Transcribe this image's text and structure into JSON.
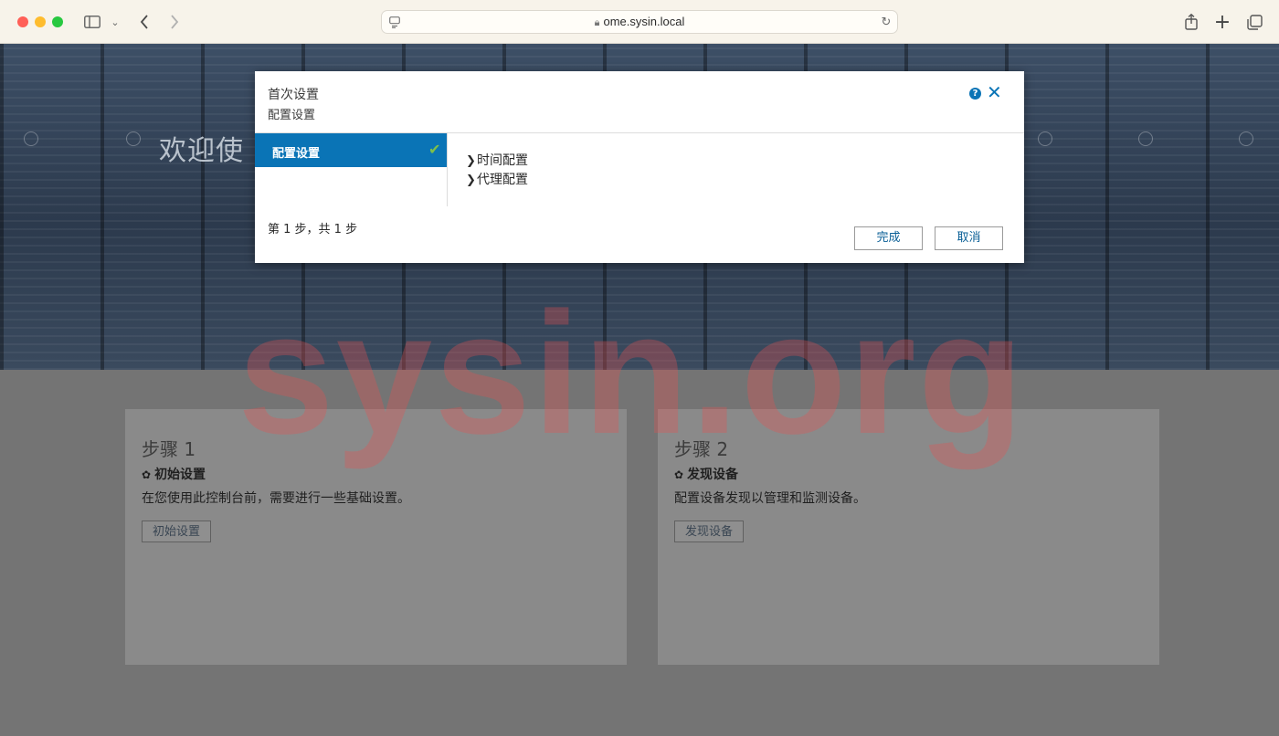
{
  "browser": {
    "url": "ome.sysin.local"
  },
  "page": {
    "welcome": "欢迎使",
    "watermark": "sysin.org"
  },
  "cards": [
    {
      "step": "步骤 1",
      "title": "初始设置",
      "description": "在您使用此控制台前，需要进行一些基础设置。",
      "button": "初始设置"
    },
    {
      "step": "步骤 2",
      "title": "发现设备",
      "description": "配置设备发现以管理和监测设备。",
      "button": "发现设备"
    }
  ],
  "dialog": {
    "title": "首次设置",
    "subtitle": "配置设置",
    "nav_item": "配置设置",
    "sections": [
      "时间配置",
      "代理配置"
    ],
    "step_count": "第 1 步，共 1 步",
    "finish": "完成",
    "cancel": "取消"
  },
  "colors": {
    "accent": "#0a74b6",
    "check": "#7ec04a"
  },
  "icons": [
    "sidebar-icon",
    "back-icon",
    "forward-icon",
    "lock-icon",
    "reload-icon",
    "share-icon",
    "new-tab-icon",
    "tabs-icon",
    "help-icon",
    "close-icon",
    "check-icon",
    "chevron-right-icon",
    "gear-icon"
  ]
}
